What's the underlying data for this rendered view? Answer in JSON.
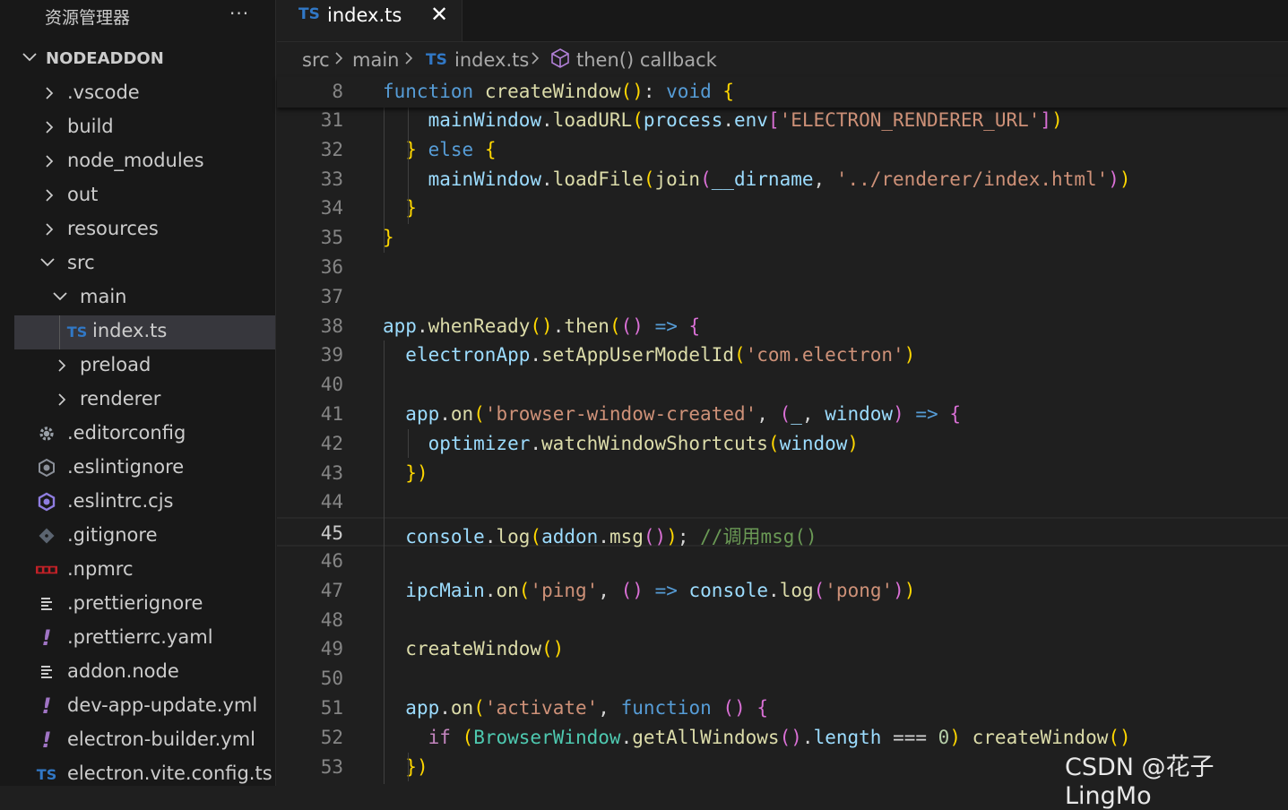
{
  "explorer": {
    "header": "资源管理器",
    "more": "···",
    "root": "NODEADDON",
    "items": [
      {
        "label": ".vscode",
        "kind": "folder-closed",
        "depth": 0
      },
      {
        "label": "build",
        "kind": "folder-closed",
        "depth": 0
      },
      {
        "label": "node_modules",
        "kind": "folder-closed",
        "depth": 0
      },
      {
        "label": "out",
        "kind": "folder-closed",
        "depth": 0
      },
      {
        "label": "resources",
        "kind": "folder-closed",
        "depth": 0
      },
      {
        "label": "src",
        "kind": "folder-open",
        "depth": 0
      },
      {
        "label": "main",
        "kind": "folder-open",
        "depth": 1
      },
      {
        "label": "index.ts",
        "kind": "file-ts",
        "depth": 2,
        "selected": true
      },
      {
        "label": "preload",
        "kind": "folder-closed",
        "depth": 1
      },
      {
        "label": "renderer",
        "kind": "folder-closed",
        "depth": 1
      },
      {
        "label": ".editorconfig",
        "kind": "gear-icon",
        "depth": 0
      },
      {
        "label": ".eslintignore",
        "kind": "eslint-ignore-icon",
        "depth": 0
      },
      {
        "label": ".eslintrc.cjs",
        "kind": "eslint-icon",
        "depth": 0
      },
      {
        "label": ".gitignore",
        "kind": "git-icon",
        "depth": 0
      },
      {
        "label": ".npmrc",
        "kind": "npm-icon",
        "depth": 0
      },
      {
        "label": ".prettierignore",
        "kind": "lines-icon",
        "depth": 0
      },
      {
        "label": ".prettierrc.yaml",
        "kind": "yaml-icon",
        "depth": 0
      },
      {
        "label": "addon.node",
        "kind": "lines-icon",
        "depth": 0
      },
      {
        "label": "dev-app-update.yml",
        "kind": "yaml-icon",
        "depth": 0
      },
      {
        "label": "electron-builder.yml",
        "kind": "yaml-icon",
        "depth": 0
      },
      {
        "label": "electron.vite.config.ts",
        "kind": "file-ts",
        "depth": 0
      }
    ]
  },
  "tabs": [
    {
      "badge": "TS",
      "label": "index.ts",
      "close": "✕"
    }
  ],
  "breadcrumb": {
    "parts": [
      "src",
      "main",
      "index.ts",
      "then() callback"
    ],
    "ts_badge": "TS"
  },
  "editor": {
    "sticky": {
      "line": "8",
      "code": "function createWindow(): void {"
    },
    "lines": [
      {
        "n": "31",
        "code": "    mainWindow.loadURL(process.env['ELECTRON_RENDERER_URL'])"
      },
      {
        "n": "32",
        "code": "  } else {"
      },
      {
        "n": "33",
        "code": "    mainWindow.loadFile(join(__dirname, '../renderer/index.html'))"
      },
      {
        "n": "34",
        "code": "  }"
      },
      {
        "n": "35",
        "code": "}"
      },
      {
        "n": "36",
        "code": ""
      },
      {
        "n": "37",
        "code": ""
      },
      {
        "n": "38",
        "code": "app.whenReady().then(() => {"
      },
      {
        "n": "39",
        "code": "  electronApp.setAppUserModelId('com.electron')"
      },
      {
        "n": "40",
        "code": ""
      },
      {
        "n": "41",
        "code": "  app.on('browser-window-created', (_, window) => {"
      },
      {
        "n": "42",
        "code": "    optimizer.watchWindowShortcuts(window)"
      },
      {
        "n": "43",
        "code": "  })"
      },
      {
        "n": "44",
        "code": ""
      },
      {
        "n": "45",
        "code": "  console.log(addon.msg()); //调用msg()",
        "current": true
      },
      {
        "n": "46",
        "code": ""
      },
      {
        "n": "47",
        "code": "  ipcMain.on('ping', () => console.log('pong'))"
      },
      {
        "n": "48",
        "code": ""
      },
      {
        "n": "49",
        "code": "  createWindow()"
      },
      {
        "n": "50",
        "code": ""
      },
      {
        "n": "51",
        "code": "  app.on('activate', function () {"
      },
      {
        "n": "52",
        "code": "    if (BrowserWindow.getAllWindows().length === 0) createWindow()"
      },
      {
        "n": "53",
        "code": "  })"
      }
    ]
  },
  "watermark": "CSDN @花子LingMo",
  "colors": {
    "ts_blue": "#3178c6",
    "selection": "#37373d",
    "background": "#1f1f1f"
  }
}
